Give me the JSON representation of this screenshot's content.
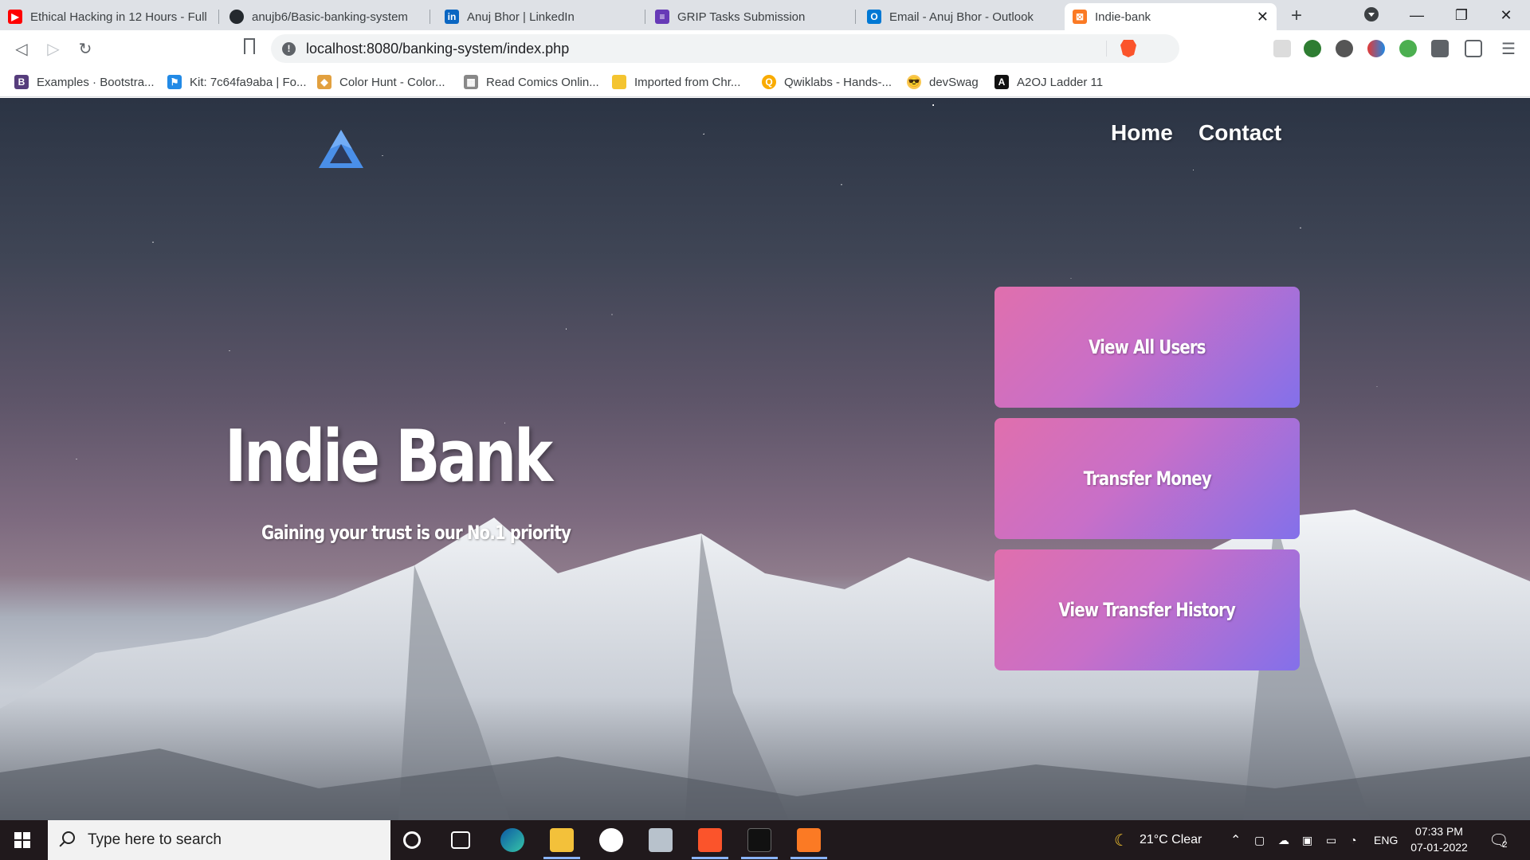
{
  "browser": {
    "tabs": [
      {
        "title": "Ethical Hacking in 12 Hours - Full",
        "icon": "youtube-icon",
        "color": "#ff0000"
      },
      {
        "title": "anujb6/Basic-banking-system",
        "icon": "github-icon",
        "color": "#24292e"
      },
      {
        "title": "Anuj Bhor | LinkedIn",
        "icon": "linkedin-icon",
        "color": "#0a66c2"
      },
      {
        "title": "GRIP Tasks Submission",
        "icon": "forms-icon",
        "color": "#673ab7"
      },
      {
        "title": "Email - Anuj Bhor - Outlook",
        "icon": "outlook-icon",
        "color": "#0078d4"
      },
      {
        "title": "Indie-bank",
        "icon": "xampp-icon",
        "color": "#fb7a24",
        "active": true
      }
    ],
    "url": "localhost:8080/banking-system/index.php",
    "bookmarks": [
      {
        "label": "Examples · Bootstra...",
        "icon": "bootstrap-icon",
        "color": "#563d7c"
      },
      {
        "label": "Kit: 7c64fa9aba | Fo...",
        "icon": "flag-icon",
        "color": "#228ae6"
      },
      {
        "label": "Color Hunt - Color...",
        "icon": "colorhunt-icon",
        "color": "#e2a03f"
      },
      {
        "label": "Read Comics Onlin...",
        "icon": "comics-icon",
        "color": "#888888"
      },
      {
        "label": "Imported from Chr...",
        "icon": "folder-icon",
        "color": "#f4c430"
      },
      {
        "label": "Qwiklabs - Hands-...",
        "icon": "qwiklabs-icon",
        "color": "#f9ab00"
      },
      {
        "label": "devSwag",
        "icon": "sunglasses-icon",
        "color": "#f9c74f"
      },
      {
        "label": "A2OJ Ladder 11",
        "icon": "a2oj-icon",
        "color": "#111111"
      }
    ]
  },
  "site": {
    "nav": {
      "home": "Home",
      "contact": "Contact"
    },
    "hero": {
      "title": "Indie Bank",
      "subtitle": "Gaining your trust is our No.1 priority"
    },
    "actions": [
      "View All Users",
      "Transfer Money",
      "View Transfer History"
    ],
    "accent_gradient": [
      "#e06fad",
      "#8370ea"
    ]
  },
  "taskbar": {
    "search_placeholder": "Type here to search",
    "weather": "21°C  Clear",
    "language": "ENG",
    "time": "07:33 PM",
    "date": "07-01-2022",
    "notification_count": "2"
  }
}
